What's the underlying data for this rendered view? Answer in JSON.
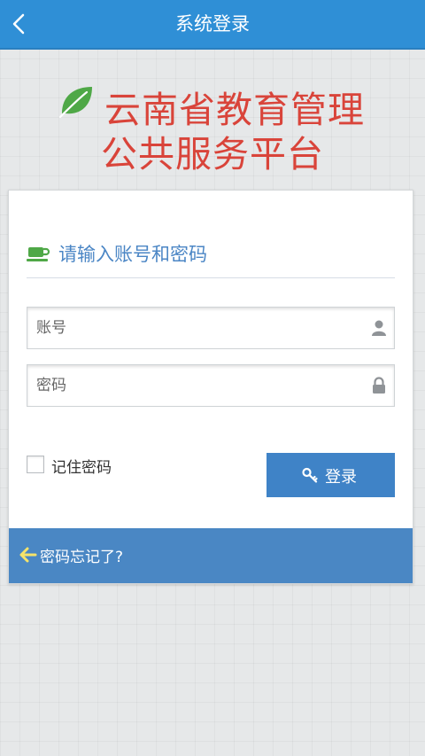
{
  "header": {
    "title": "系统登录",
    "back_icon": "chevron-left-icon"
  },
  "brand": {
    "icon": "leaf-icon",
    "line1": "云南省教育管理",
    "line2": "公共服务平台",
    "colors": {
      "title": "#d9443a",
      "leaf": "#4fa847"
    }
  },
  "login_card": {
    "heading_icon": "cup-icon",
    "heading": "请输入账号和密码",
    "account": {
      "placeholder": "账号",
      "value": "",
      "icon": "user-icon"
    },
    "password": {
      "placeholder": "密码",
      "value": "",
      "icon": "lock-icon"
    },
    "remember": {
      "label": "记住密码",
      "checked": false
    },
    "login_button": {
      "label": "登录",
      "icon": "key-icon"
    },
    "forgot": {
      "label": "密码忘记了?",
      "icon": "arrow-left-icon"
    }
  },
  "colors": {
    "topbar": "#2f8fd6",
    "accent": "#4a87c4",
    "heading_text": "#4b86c5"
  }
}
